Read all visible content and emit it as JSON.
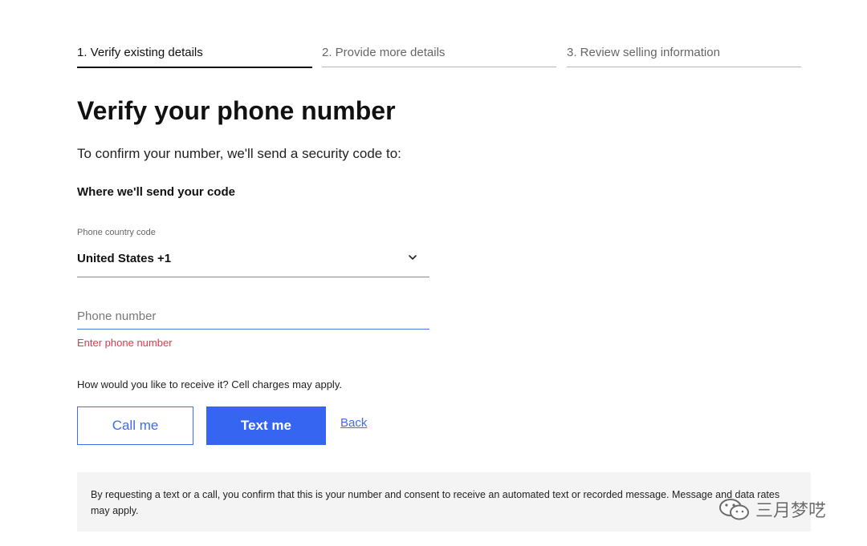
{
  "stepper": {
    "steps": [
      {
        "label": "1. Verify existing details",
        "active": true
      },
      {
        "label": "2. Provide more details",
        "active": false
      },
      {
        "label": "3. Review selling information",
        "active": false
      }
    ]
  },
  "title": "Verify your phone number",
  "intro": "To confirm your number, we'll send a security code to:",
  "section_heading": "Where we'll send your code",
  "country_field": {
    "caption": "Phone country code",
    "value": "United States +1",
    "icon": "chevron-down-icon"
  },
  "phone_field": {
    "placeholder": "Phone number",
    "value": "",
    "error": "Enter phone number"
  },
  "receive_prompt": "How would you like to receive it? Cell charges may apply.",
  "actions": {
    "call_label": "Call me",
    "text_label": "Text me",
    "back_label": "Back"
  },
  "disclaimer": "By requesting a text or a call, you confirm that this is your number and consent to receive an automated text or recorded message. Message and data rates may apply.",
  "watermark": {
    "text": "三月梦呓",
    "icon": "wechat-icon"
  },
  "colors": {
    "accent": "#3565f1",
    "error": "#e0384a",
    "disclaimer_bg": "#f4f4f4"
  }
}
